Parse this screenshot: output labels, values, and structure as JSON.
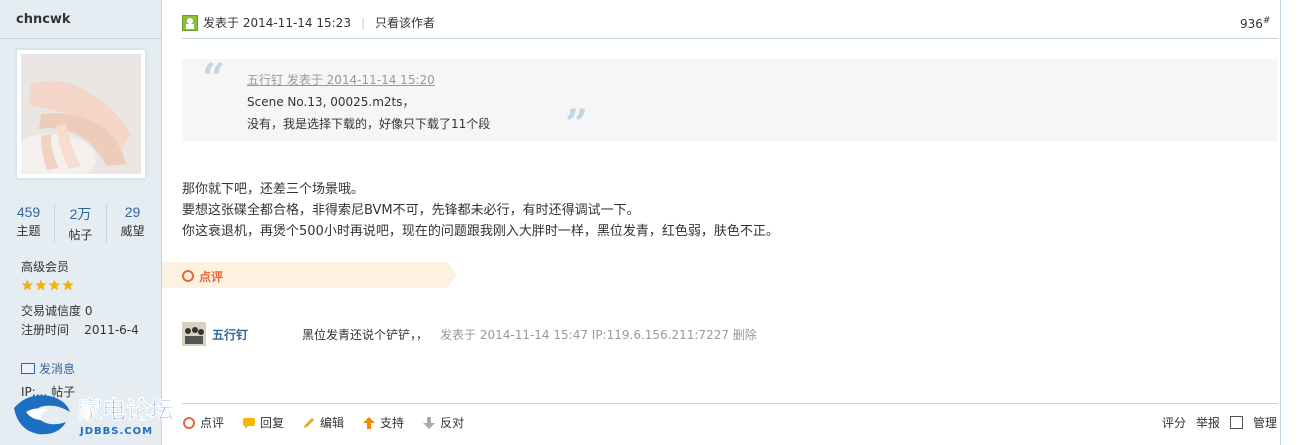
{
  "author": {
    "name": "chncwk",
    "stats": [
      {
        "value": "459",
        "label": "主题"
      },
      {
        "value": "2万",
        "label": "帖子"
      },
      {
        "value": "29",
        "label": "威望"
      }
    ],
    "group": "高级会员",
    "stars": 4,
    "credit": "交易诚信度 0",
    "reg_label": "注册时间",
    "reg_date": "2011-6-4",
    "send_msg": "发消息",
    "ip_line": "IP:... 帖子"
  },
  "logo": {
    "text": "家电论坛",
    "sub": "JDBBS.COM"
  },
  "post": {
    "posted": "发表于 2014-11-14 15:23",
    "only_author": "只看该作者",
    "floor": "936",
    "floor_mark": "#",
    "quote": {
      "head": "五行钉 发表于 2014-11-14 15:20",
      "lines": [
        "Scene No.13, 00025.m2ts，",
        "没有，我是选择下载的，好像只下载了11个段"
      ]
    },
    "body": [
      "那你就下吧，还差三个场景哦。",
      "要想这张碟全都合格，非得索尼BVM不可，先锋都未必行，有时还得调试一下。",
      "你这衰退机，再煲个500小时再说吧，现在的问题跟我刚入大胖时一样，黑位发青，红色弱，肤色不正。"
    ],
    "rate_label": "点评",
    "comment": {
      "user": "五行钉",
      "text": "黑位发青还说个铲铲，，",
      "meta": "发表于 2014-11-14 15:47 IP:119.6.156.211:7227 删除"
    }
  },
  "actions": {
    "left": [
      "点评",
      "回复",
      "编辑",
      "支持",
      "反对"
    ],
    "right": [
      "评分",
      "举报",
      "管理"
    ]
  }
}
